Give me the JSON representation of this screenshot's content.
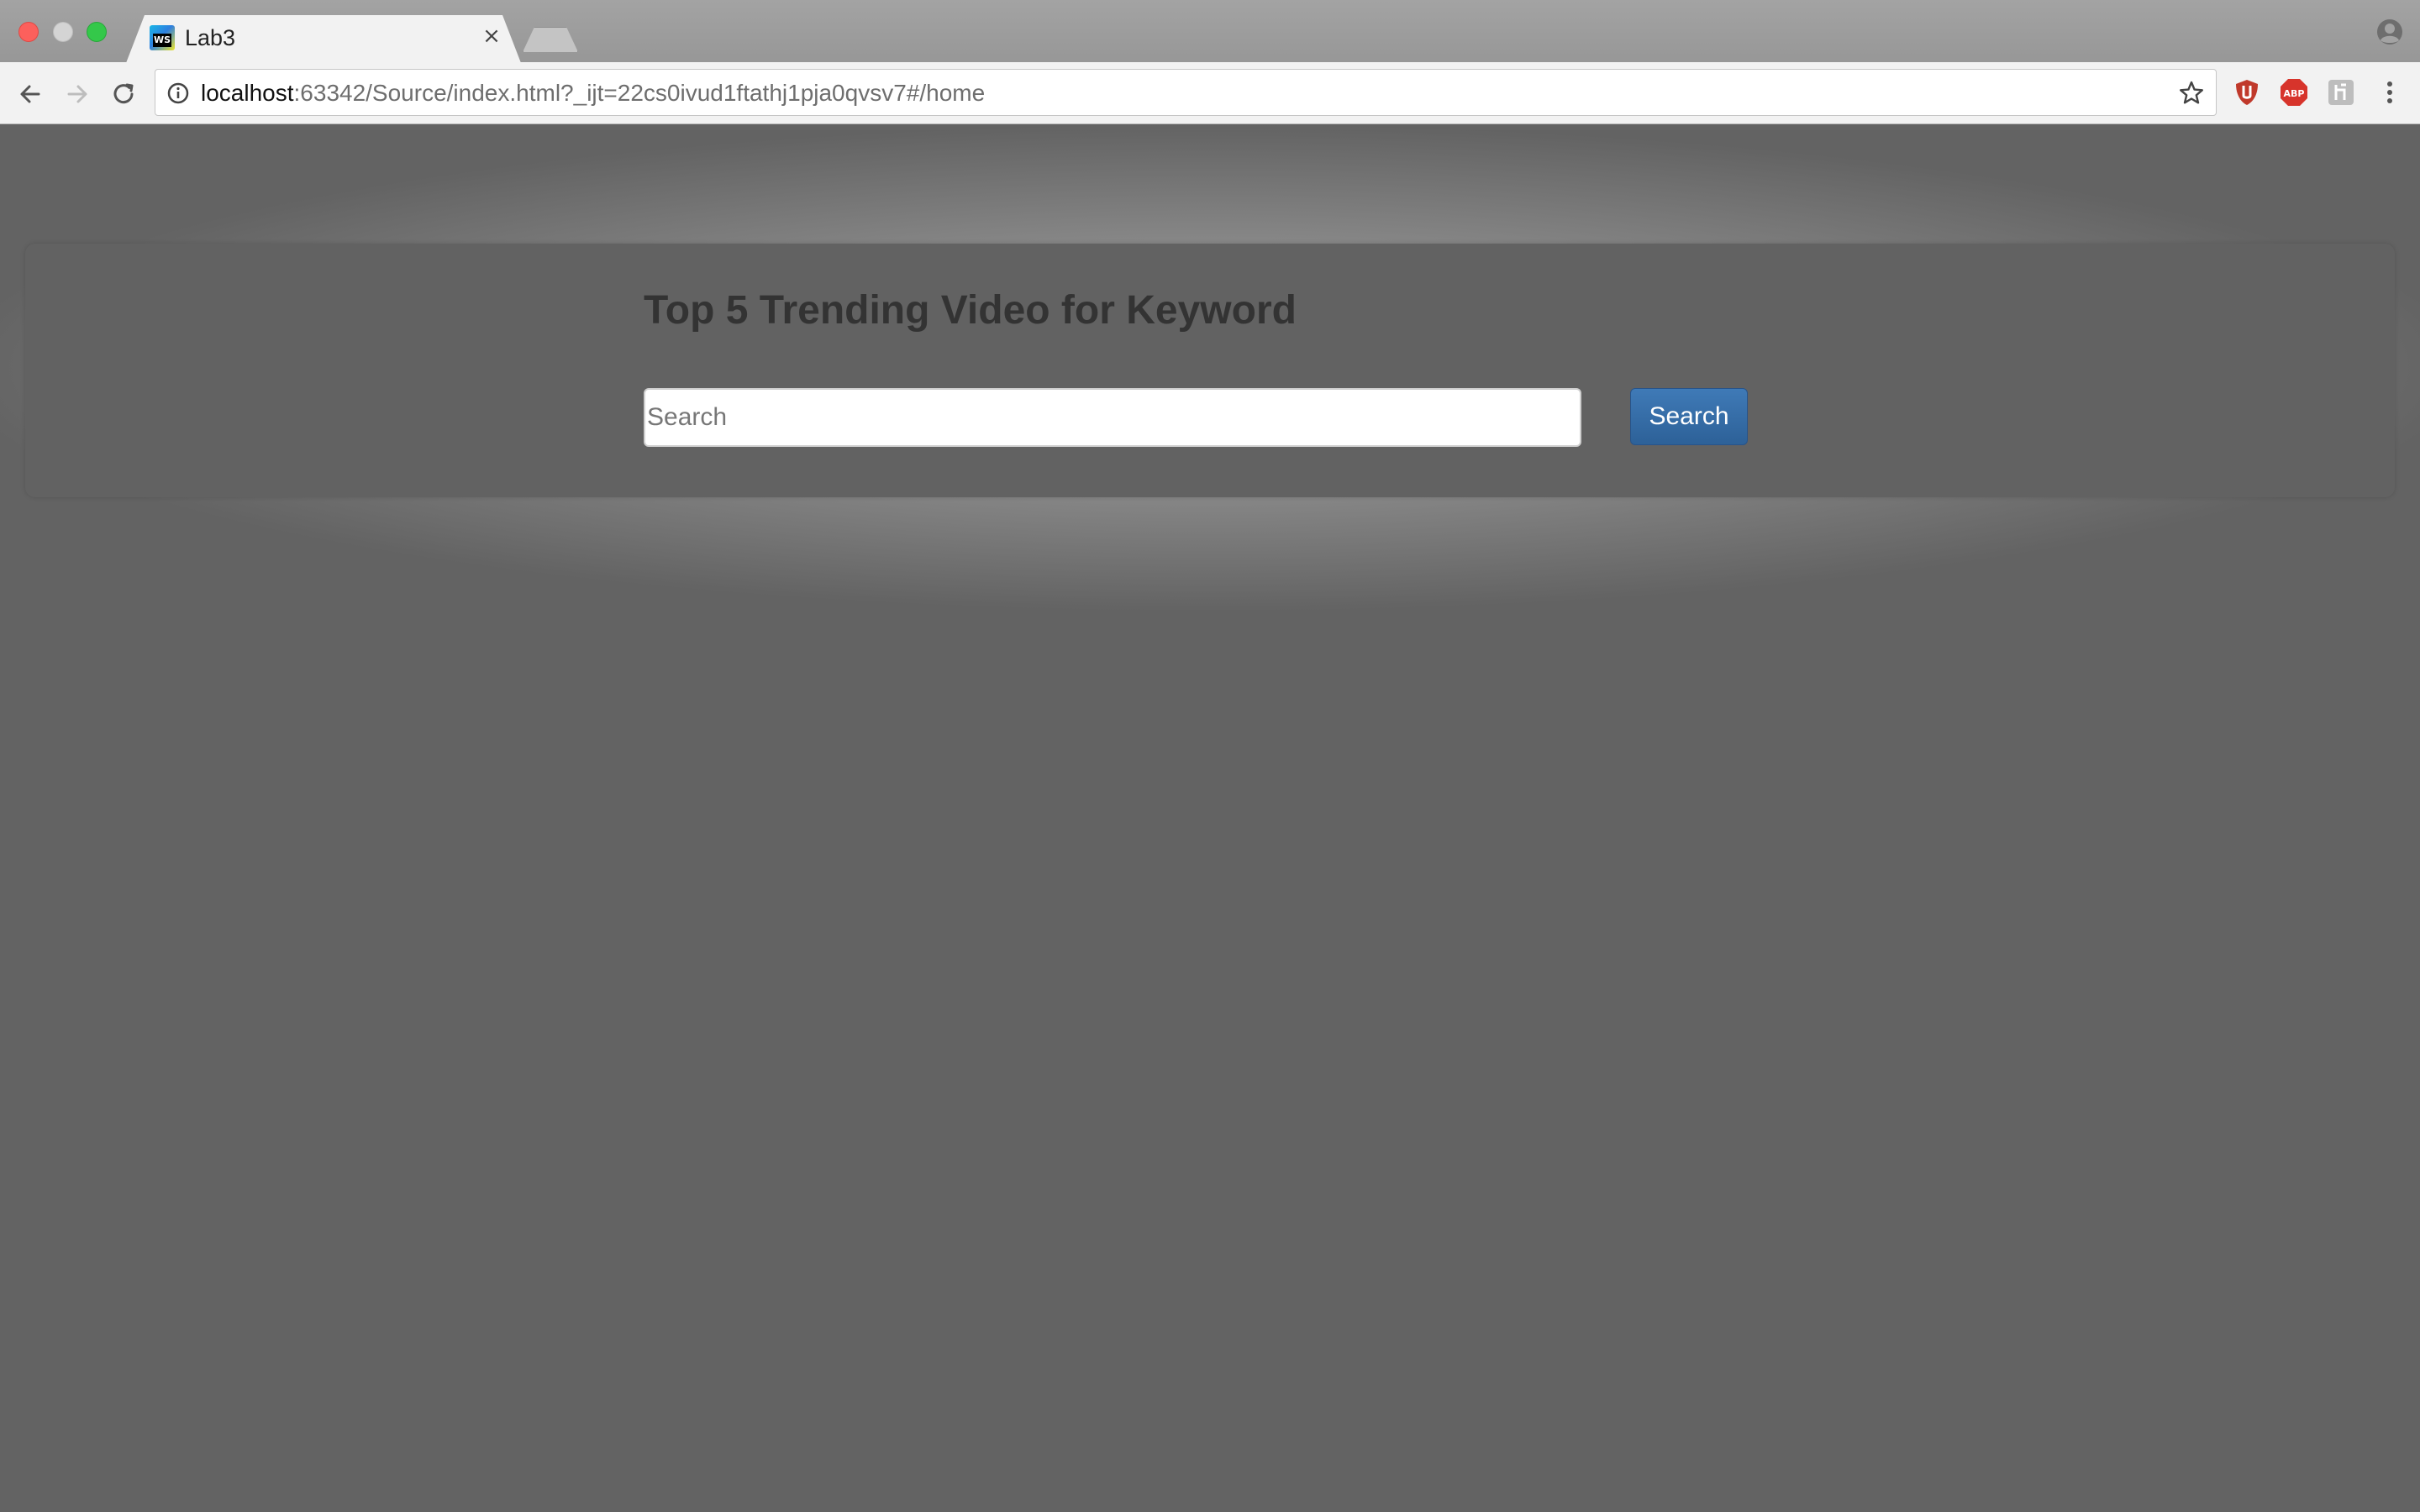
{
  "browser": {
    "tab_title": "Lab3",
    "tab_favicon_text": "WS",
    "tab_close_glyph": "×",
    "url_host": "localhost",
    "url_rest": ":63342/Source/index.html?_ijt=22cs0ivud1ftathj1pja0qvsv7#/home",
    "extensions": [
      "ublock-icon",
      "adblock-plus-icon",
      "extension-icon"
    ],
    "abp_label": "ABP"
  },
  "page": {
    "heading": "Top 5 Trending Video for Keyword",
    "search_placeholder": "Search",
    "search_value": "",
    "search_button_label": "Search"
  },
  "colors": {
    "page_background": "#636363",
    "button_primary": "#337ab7"
  }
}
